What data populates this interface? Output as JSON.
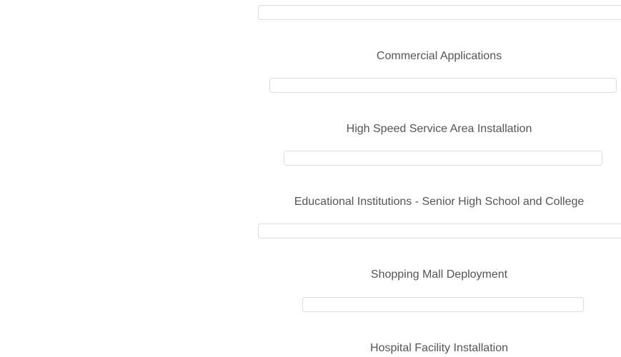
{
  "menu": {
    "items": [
      {
        "label": ""
      },
      {
        "label": "Commercial Applications"
      },
      {
        "label": "High Speed Service Area Installation"
      },
      {
        "label": "Educational Institutions - Senior High School and College"
      },
      {
        "label": "Shopping Mall Deployment"
      },
      {
        "label": "Hospital Facility Installation"
      }
    ]
  }
}
